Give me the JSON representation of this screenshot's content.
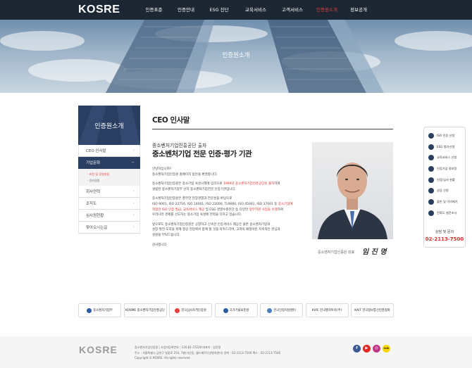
{
  "header": {
    "logo": "KOSRE",
    "nav": [
      {
        "label": "인증표준",
        "active": false
      },
      {
        "label": "인증안내",
        "active": false
      },
      {
        "label": "ESG 진단",
        "active": false
      },
      {
        "label": "교육서비스",
        "active": false
      },
      {
        "label": "고객서비스",
        "active": false
      },
      {
        "label": "인증원소개",
        "active": true
      },
      {
        "label": "정보공개",
        "active": false
      }
    ]
  },
  "banner": {
    "title": "인증원소개"
  },
  "sidebar": {
    "title": "인증원소개",
    "items": [
      "CEO 인사말",
      "기업문화",
      "회사연혁",
      "조직도",
      "심사원현황",
      "찾아오시는길"
    ],
    "sub_items": [
      "- 비전 및 경영방침",
      "- 윤리경영"
    ]
  },
  "content": {
    "title": "CEO 인사말",
    "subtitle": "중소벤처기업진흥공단 출자",
    "headline": "중소벤처기업 전문 인증·평가 기관",
    "p1": [
      "안녕하십니까?",
      "중소벤처기업인증원 홈페이지 방문을 환영합니다."
    ],
    "p2": {
      "l1a": "중소벤처기업인증원은 중소기업 육성시책에 입각으로 ",
      "l1red": "1999년 중소벤처기업진흥공단의 출자",
      "l1b": "하여",
      "l2": "설립된 중소벤처기업부 산하 중소벤처기업전문 인증기관입니다."
    },
    "p3": {
      "l1": "중소벤처기업인증원은 풍부한 현장경험과 전문성을 바탕으로",
      "l2a": "ISO 9001, ISO 22716, ISO 14001, ISO 22000, TL9000, ISO 45001, ISO 37001 등 ",
      "l2red": "중소기업에",
      "l3red": "적합한 ISO 인증 발급, 교육서비스 제공",
      "l3b": " 및 ESG 경영수준진단 등 다양한 ",
      "l3red2": "정부지원 사업을 수행",
      "l3c": "하여",
      "l4": "우리나라 경제를 선도하는 중소기업 육성에 전력을 다하고 있습니다."
    },
    "p4": [
      "앞으로도 중소벤처기업인증원은 공정하고 신속한 인증서비스 제공은 물론 중소벤처기업의",
      "성장·발전·도약을 위해 항상 현장에서 함께 할 것을 약속드리며, 고객의 애정어린 지속적인 관심과",
      "성원을 부탁드립니다."
    ],
    "p5": "감사합니다.",
    "signature_label": "중소벤처기업인증원 대표",
    "signature": "임 진 명"
  },
  "quick_menu": {
    "items": [
      "ISO 인증 신청",
      "ESG 평가신청",
      "교육서비스 신청",
      "인증기업 정보망",
      "인증/심사 현황",
      "상담 신청",
      "불만 및 이의제기",
      "전화도 설문조사"
    ],
    "phone_label": "상담 및 문의",
    "phone": "02-2113-7500"
  },
  "partners": [
    "중소벤처기업부",
    "KOSME 중소벤처기업진흥공단",
    "한국심사자격인증원",
    "국가기술표준원",
    "한국인정지원센터",
    "KVIC 한국벤처투자(주)",
    "KAIT 한국정보통신진흥협회"
  ],
  "footer": {
    "logo": "KOSRE",
    "line1": "중소벤처기업인증원  |  사업자등록번호 : 116-81-37228  대표자 : 임진명",
    "line2": "주소 : 서울특별시 금천구 벚꽃로 254, 7층(가산동, 월드메르디앙벤처센터)  전화 : 02-2113-7500  팩스 : 02-2113-7540",
    "line3": "Copyright © KOSRE. All rights reserved.",
    "sns": [
      "f",
      "▶",
      "◎",
      "talk"
    ]
  },
  "colors": {
    "accent": "#d8312b",
    "navy": "#2a3e61",
    "header": "#1d2733"
  }
}
